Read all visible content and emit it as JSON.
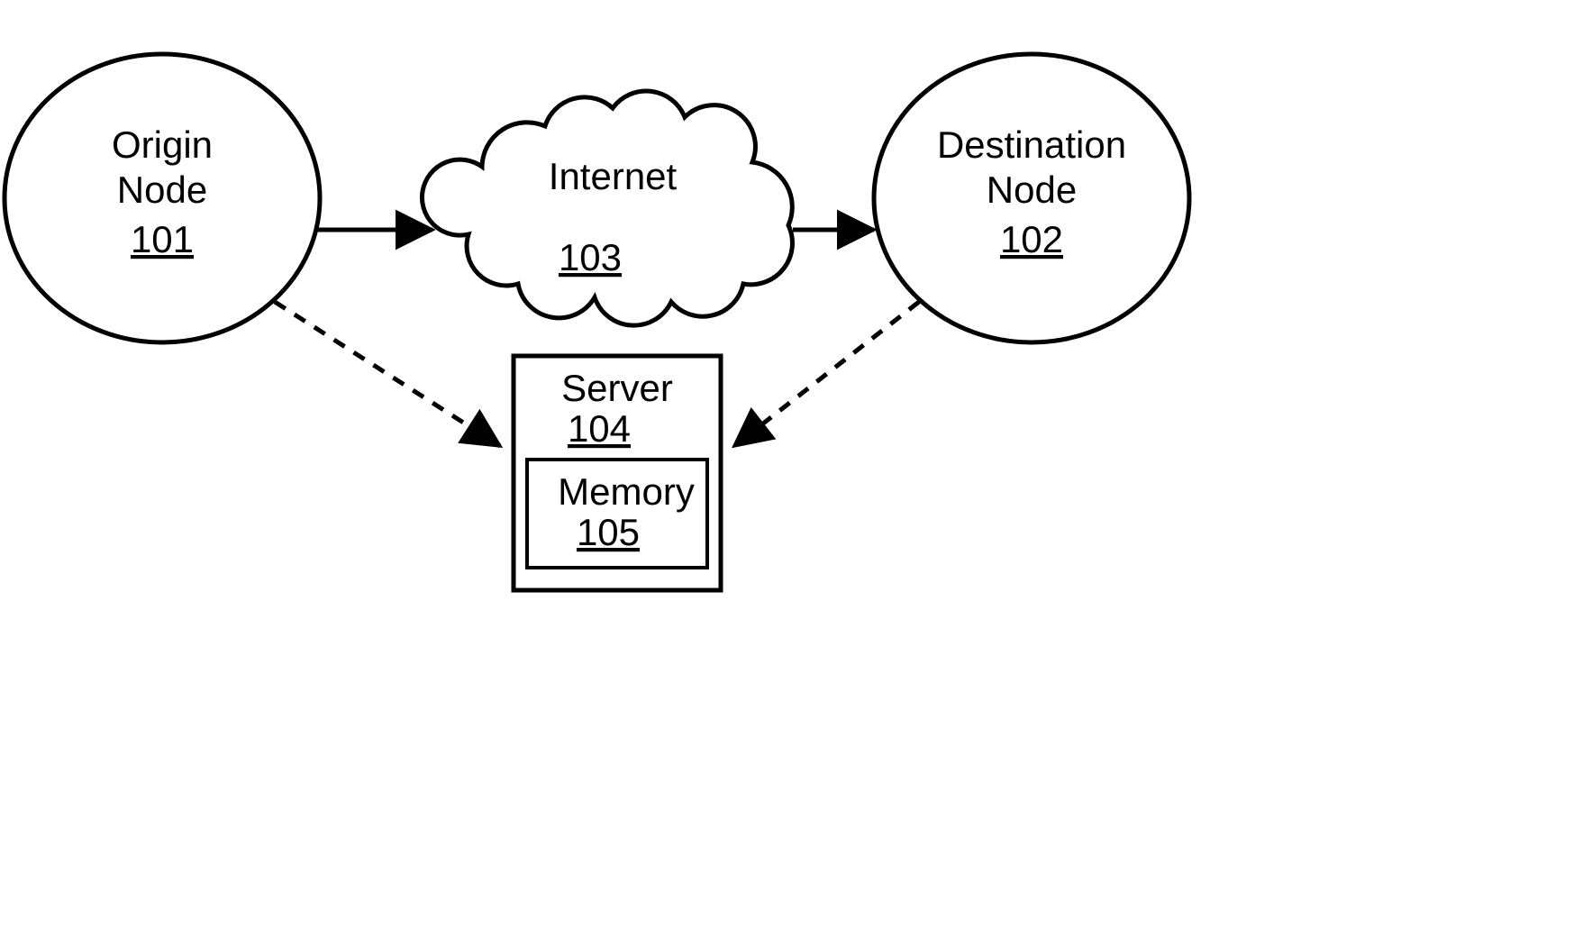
{
  "nodes": {
    "origin": {
      "label": "Origin\nNode",
      "ref": "101"
    },
    "destination": {
      "label": "Destination\nNode",
      "ref": "102"
    },
    "internet": {
      "label": "Internet",
      "ref": "103"
    },
    "server": {
      "label": "Server",
      "ref": "104"
    },
    "memory": {
      "label": "Memory",
      "ref": "105"
    }
  },
  "edges": [
    {
      "from": "origin",
      "to": "internet",
      "style": "solid",
      "arrow": "end"
    },
    {
      "from": "internet",
      "to": "destination",
      "style": "solid",
      "arrow": "end"
    },
    {
      "from": "origin",
      "to": "server",
      "style": "dashed",
      "arrow": "end"
    },
    {
      "from": "destination",
      "to": "server",
      "style": "dashed",
      "arrow": "end"
    }
  ]
}
